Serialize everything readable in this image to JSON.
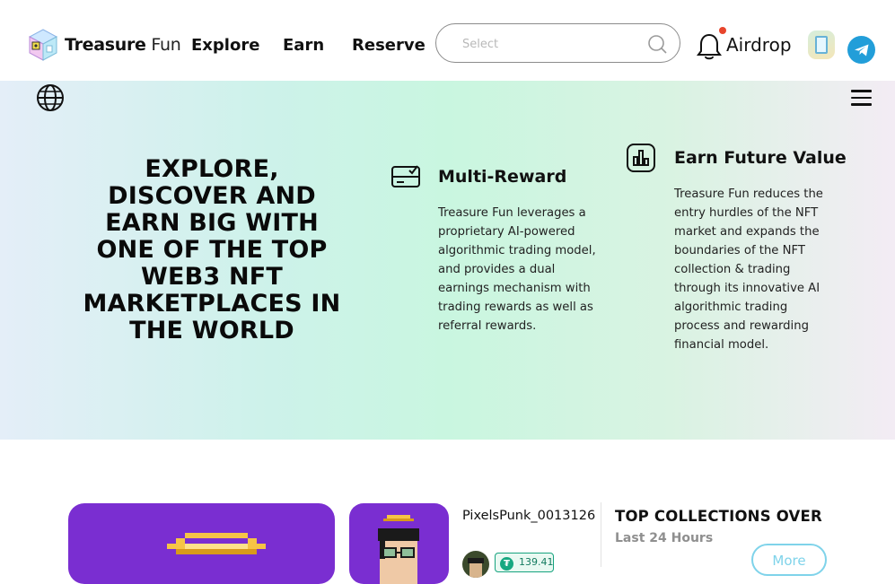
{
  "header": {
    "logo": {
      "brand_bold": "Treasure",
      "brand_light": "Fun",
      "icon": "treasure-cube-logo"
    },
    "nav": [
      {
        "label": "Explore"
      },
      {
        "label": "Earn"
      },
      {
        "label": "Reserve"
      }
    ],
    "search": {
      "placeholder": "Select",
      "value": "",
      "icon": "search-icon"
    },
    "notifications": {
      "icon": "bell-icon",
      "has_unread": true
    },
    "airdrop_label": "Airdrop",
    "app_icon": "app-download-icon",
    "telegram_icon": "telegram-icon"
  },
  "hero": {
    "language_icon": "globe-icon",
    "menu_icon": "hamburger-menu-icon",
    "headline": "EXPLORE, DISCOVER AND EARN BIG WITH ONE OF THE TOP WEB3 NFT MARKETPLACES IN THE WORLD",
    "features": [
      {
        "icon": "reward-card-icon",
        "title": "Multi-Reward",
        "text": "Treasure Fun leverages a proprietary AI-powered algorithmic trading model, and provides a dual earnings mechanism with trading rewards as well as referral rewards."
      },
      {
        "icon": "chart-bars-icon",
        "title": "Earn Future Value",
        "text": "Treasure Fun reduces the entry hurdles of the NFT market and expands the boundaries of the NFT collection & trading through its innovative AI algorithmic trading process and rewarding financial model."
      }
    ]
  },
  "featured_nft": {
    "name": "PixelsPunk_0013126",
    "price": "139.41",
    "currency_icon": "tether-icon"
  },
  "top_collections": {
    "title": "TOP COLLECTIONS OVER",
    "subtitle": "Last 24 Hours",
    "more_label": "More"
  },
  "colors": {
    "accent_purple": "#7a2ed1",
    "telegram_blue": "#229ed9",
    "notification_dot": "#e8452c",
    "price_green": "#16a37f",
    "more_button": "#7fd3ea"
  }
}
